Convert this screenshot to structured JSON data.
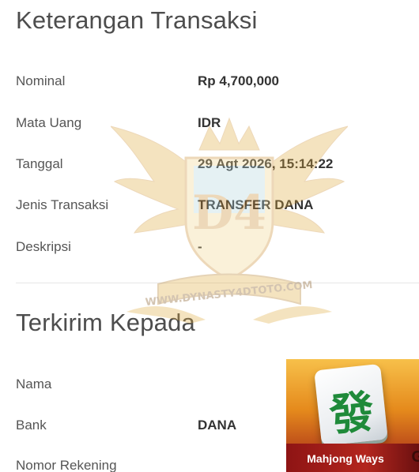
{
  "details": {
    "title": "Keterangan Transaksi",
    "rows": [
      {
        "label": "Nominal",
        "value": "Rp 4,700,000"
      },
      {
        "label": "Mata Uang",
        "value": "IDR"
      },
      {
        "label": "Tanggal",
        "value": "29 Agt 2026, 15:14:22"
      },
      {
        "label": "Jenis Transaksi",
        "value": "TRANSFER DANA"
      },
      {
        "label": "Deskripsi",
        "value": "-"
      }
    ]
  },
  "recipient": {
    "title": "Terkirim Kepada",
    "rows": [
      {
        "label": "Nama",
        "value": ""
      },
      {
        "label": "Bank",
        "value": "DANA"
      },
      {
        "label": "Nomor Rekening",
        "value": ""
      }
    ]
  },
  "watermark": {
    "monogram": "D4",
    "url_text": "WWW.DYNASTY4DTOTO.COM"
  },
  "game_card": {
    "glyph": "發",
    "label": "Mahjong Ways",
    "edge_text": "G"
  }
}
